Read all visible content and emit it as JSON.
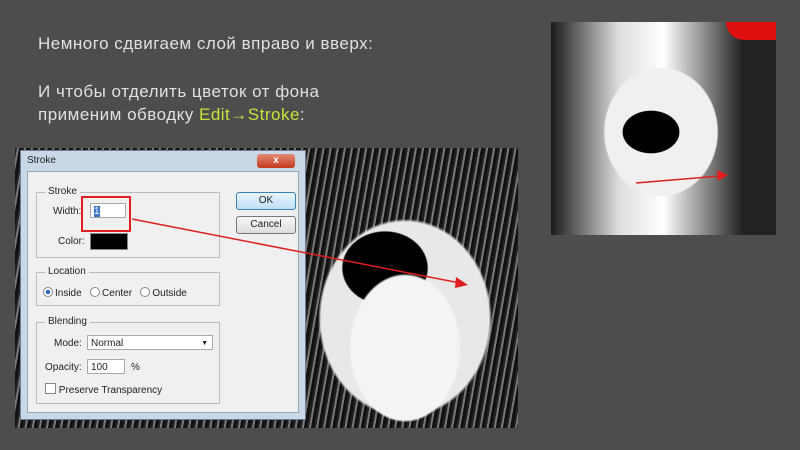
{
  "slide": {
    "line1": "Немного сдвигаем слой вправо и вверх:",
    "line2": "И  чтобы отделить цветок от фона",
    "line3_pre": "применим обводку  ",
    "line3_hl": "Edit→Stroke",
    "line3_post": ":"
  },
  "colors": {
    "background": "#4d4d4d",
    "highlight": "#c6e33a",
    "arrow": "#e02020"
  },
  "dialog": {
    "title": "Stroke",
    "close": "x",
    "ok": "OK",
    "cancel": "Cancel",
    "stroke_group": "Stroke",
    "width_label": "Width:",
    "width_value": "1",
    "color_label": "Color:",
    "location_group": "Location",
    "inside": "Inside",
    "center": "Center",
    "outside": "Outside",
    "blending_group": "Blending",
    "mode_label": "Mode:",
    "mode_value": "Normal",
    "opacity_label": "Opacity:",
    "opacity_value": "100",
    "percent": "%",
    "preserve": "Preserve Transparency"
  }
}
